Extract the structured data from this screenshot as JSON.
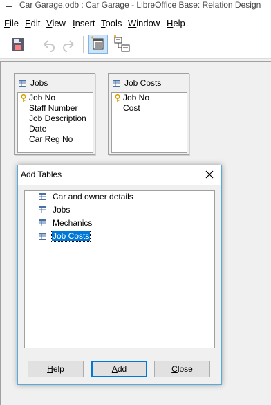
{
  "window": {
    "title": "Car Garage.odb : Car Garage - LibreOffice Base: Relation Design"
  },
  "menu": [
    {
      "label": "File",
      "accel": "F",
      "rest": "ile"
    },
    {
      "label": "Edit",
      "accel": "E",
      "rest": "dit"
    },
    {
      "label": "View",
      "accel": "V",
      "rest": "iew"
    },
    {
      "label": "Insert",
      "accel": "I",
      "rest": "nsert"
    },
    {
      "label": "Tools",
      "accel": "T",
      "rest": "ools"
    },
    {
      "label": "Window",
      "accel": "W",
      "rest": "indow"
    },
    {
      "label": "Help",
      "accel": "H",
      "rest": "elp"
    }
  ],
  "toolbar": {
    "save_icon": "save-icon",
    "undo_icon": "undo-icon",
    "redo_icon": "redo-icon",
    "add_tables_icon": "add-tables-icon",
    "new_relation_icon": "new-relation-icon"
  },
  "tables": [
    {
      "name": "Jobs",
      "fields": [
        {
          "name": "Job No",
          "key": true
        },
        {
          "name": "Staff Number",
          "key": false
        },
        {
          "name": "Job Description",
          "key": false
        },
        {
          "name": "Date",
          "key": false
        },
        {
          "name": "Car Reg No",
          "key": false
        }
      ]
    },
    {
      "name": "Job Costs",
      "fields": [
        {
          "name": "Job No",
          "key": true
        },
        {
          "name": "Cost",
          "key": false
        }
      ]
    }
  ],
  "dialog": {
    "title": "Add Tables",
    "items": [
      {
        "label": "Car and owner details",
        "selected": false
      },
      {
        "label": "Jobs",
        "selected": false
      },
      {
        "label": "Mechanics",
        "selected": false
      },
      {
        "label": "Job Costs",
        "selected": true
      }
    ],
    "buttons": {
      "help": {
        "accel": "H",
        "rest": "elp"
      },
      "add": {
        "accel": "A",
        "rest": "dd"
      },
      "close": {
        "accel": "C",
        "rest": "lose"
      }
    }
  }
}
